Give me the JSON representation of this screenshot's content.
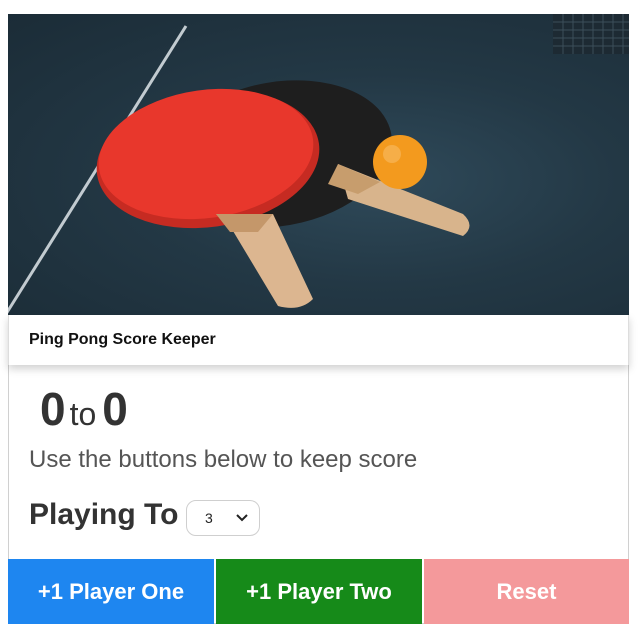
{
  "caption": {
    "title": "Ping Pong Score Keeper"
  },
  "score": {
    "player_one": "0",
    "separator": "to",
    "player_two": "0"
  },
  "instructions": "Use the buttons below to keep score",
  "playing_to": {
    "label": "Playing To",
    "selected": "3"
  },
  "buttons": {
    "player_one": "+1 Player One",
    "player_two": "+1 Player Two",
    "reset": "Reset"
  },
  "colors": {
    "player_one_button": "#1e86f0",
    "player_two_button": "#168a19",
    "reset_button": "#f4999b",
    "paddle_red": "#e8372c",
    "ball_orange": "#f39a1e"
  },
  "icons": {
    "select_arrow": "chevron-down-icon"
  }
}
